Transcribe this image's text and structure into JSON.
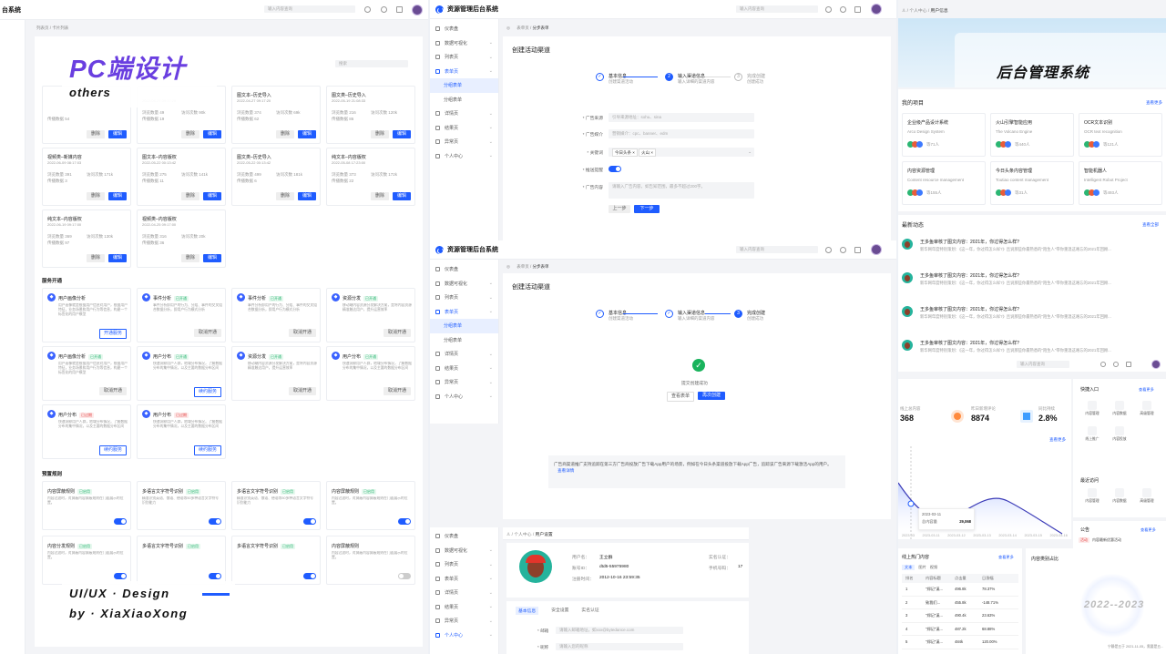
{
  "left_app": {
    "title": "台系统",
    "search_placeholder": "输入内容查询",
    "breadcrumb": "列表页 / 卡片列表",
    "filter_placeholder": "搜索"
  },
  "overlay": {
    "title": "PC端设计",
    "subtitle": "others",
    "footer1": "UI/UX · Design",
    "footer2": "by · XiaXiaoXong"
  },
  "content_cards": [
    {
      "title": "",
      "date": "",
      "m1": "",
      "m2": "",
      "m3": "传播数据 54",
      "m4": ""
    },
    {
      "title": "",
      "date": "2022-04-27 09:17:20",
      "m1": "浏览数量 49",
      "m2": "",
      "m3": "传播数据 19",
      "m4": "访问次数 90k"
    },
    {
      "title": "图文本–历史导入",
      "date": "2022-04-27 09:17:20",
      "m1": "浏览数量 374",
      "m2": "",
      "m3": "传播数据 62",
      "m4": "访问次数 69k"
    },
    {
      "title": "图文类–历史导入",
      "date": "2022-05-19 21:08:33",
      "m1": "浏览数量 216",
      "m2": "",
      "m3": "传播数据 86",
      "m4": "访问次数 120k"
    },
    {
      "title": "视频类–新媒内容",
      "date": "2022-06-09 08:17:03",
      "m1": "浏览数量 391",
      "m2": "",
      "m3": "传播数据 3",
      "m4": "访问次数 171k"
    },
    {
      "title": "图文本–内容版权",
      "date": "2022-05-22 00:13:42",
      "m1": "浏览数量 275",
      "m2": "",
      "m3": "传播数据 11",
      "m4": "访问次数 141k"
    },
    {
      "title": "图文类–历史导入",
      "date": "2022-05-22 00:13:42",
      "m1": "浏览数量 499",
      "m2": "",
      "m3": "传播数据 6",
      "m4": "访问次数 181k"
    },
    {
      "title": "纯文本–内容版权",
      "date": "2022-05-08 17:23:00",
      "m1": "浏览数量 373",
      "m2": "",
      "m3": "传播数据 22",
      "m4": "访问次数 172k"
    },
    {
      "title": "纯文本–内容版权",
      "date": "2022-06-19 09:17:00",
      "m1": "浏览数量 369",
      "m2": "",
      "m3": "传播数据 97",
      "m4": "访问次数 130k"
    },
    {
      "title": "视频类–内容版权",
      "date": "2022-04-25 09:17:00",
      "m1": "浏览数量 316",
      "m2": "",
      "m3": "传播数据 36",
      "m4": "访问次数 20k"
    }
  ],
  "card_btns": {
    "del": "删除",
    "edit": "编辑"
  },
  "service_title": "服务开通",
  "services": [
    {
      "title": "用户画像分析",
      "tag": "",
      "tagc": "",
      "desc": "用户画像就是根据用户信息对用户，根据用户特征，业务场景和用户行为等信息，构建一个标签化的用户模型",
      "btn": "开通服务",
      "btnc": "o"
    },
    {
      "title": "事件分析",
      "tag": "已开通",
      "tagc": "g",
      "desc": "事件分析即用户的行为、分组、事件的交叉组合数据分析，即用户行为模式分析",
      "btn": "取消开通",
      "btnc": "d"
    },
    {
      "title": "事件分析",
      "tag": "已开通",
      "tagc": "g",
      "desc": "事件分析即用户的行为、分组、事件的交叉组合数据分析，即用户行为模式分析",
      "btn": "取消开通",
      "btnc": "d"
    },
    {
      "title": "资源分发",
      "tag": "已开通",
      "tagc": "g",
      "desc": "移动端内容资源分发解决方案，是将内容资源精准触达用户，提升运营效率",
      "btn": "取消开通",
      "btnc": "d"
    },
    {
      "title": "用户画像分析",
      "tag": "已开通",
      "tagc": "g",
      "desc": "用户画像就是根据用户信息对用户，根据用户特征，业务场景和用户行为等信息，构建一个标签化的用户模型",
      "btn": "取消开通",
      "btnc": "d"
    },
    {
      "title": "用户分布",
      "tag": "已开通",
      "tagc": "g",
      "desc": "快速洞察用户人群，地域分布情况，了解数据分布的集中情况，以及主要的数据分布区间",
      "btn": "续约服务",
      "btnc": "o"
    },
    {
      "title": "资源分发",
      "tag": "已开通",
      "tagc": "g",
      "desc": "移动端内容资源分发解决方案，是将内容资源精准触达用户，提升运营效率",
      "btn": "取消开通",
      "btnc": "d"
    },
    {
      "title": "用户分布",
      "tag": "已开通",
      "tagc": "g",
      "desc": "快速洞察用户人群，地域分布情况，了解数据分布的集中情况，以及主要的数据分布区间",
      "btn": "取消开通",
      "btnc": "d"
    },
    {
      "title": "用户分布",
      "tag": "已过期",
      "tagc": "r",
      "desc": "快速洞察用户人群，地域分布情况，了解数据分布的集中情况，以及主要的数据分布区间",
      "btn": "续约服务",
      "btnc": "o"
    },
    {
      "title": "用户分布",
      "tag": "已过期",
      "tagc": "r",
      "desc": "快速洞察用户人群，地域分布情况，了解数据分布的集中情况，以及主要的数据分布区间",
      "btn": "续约服务",
      "btnc": "o"
    }
  ],
  "preset_title": "预置规则",
  "rules": [
    {
      "title": "内容屏蔽规则",
      "tag": "已启用",
      "desc": "内容过滤时，对屏蔽内容屏蔽规则在门面展示的位置。",
      "on": true
    },
    {
      "title": "多语言文字符号识别",
      "tag": "已启用",
      "desc": "精准识别英语、俄语、德语等50多种语言文字符号识别能力",
      "on": true
    },
    {
      "title": "多语言文字符号识别",
      "tag": "已启用",
      "desc": "精准识别英语、俄语、德语等50多种语言文字符号识别能力",
      "on": true
    },
    {
      "title": "内容屏蔽规则",
      "tag": "已启用",
      "desc": "内容过滤时，对屏蔽内容屏蔽规则在门面展示的位置。",
      "on": true
    },
    {
      "title": "内容分发规则",
      "tag": "已启用",
      "desc": "内容过滤时，对屏蔽内容屏蔽规则在门面展示的位置。",
      "on": true
    },
    {
      "title": "多语言文字符号识别",
      "tag": "已启用",
      "desc": "",
      "on": true
    },
    {
      "title": "多语言文字符号识别",
      "tag": "已启用",
      "desc": "",
      "on": true
    },
    {
      "title": "内容屏蔽规则",
      "tag": "",
      "desc": "内容过滤时，对屏蔽内容屏蔽规则在门面展示的位置。",
      "on": false
    }
  ],
  "mid_app": {
    "title": "资源管理后台系统",
    "search_placeholder": "输入内容查询",
    "breadcrumb1": "表单页",
    "breadcrumb2": "分步表单",
    "page_title": "创建活动渠道"
  },
  "menu": [
    "仪表盘",
    "数据可视化",
    "列表页",
    "表单页",
    "分组表单",
    "分组表单",
    "详情页",
    "结果页",
    "异常页",
    "个人中心"
  ],
  "steps": [
    {
      "n": "1",
      "t": "基本信息",
      "d": "创建渠道活动"
    },
    {
      "n": "2",
      "t": "输入渠道信息",
      "d": "输入详细的渠道内容"
    },
    {
      "n": "3",
      "t": "完成创建",
      "d": "创建成功"
    }
  ],
  "form": {
    "l1": "* 广告来源",
    "v1": "引导来源地址：sohu、sina",
    "l2": "* 广告媒介",
    "v2": "营销媒介：cpc、banner、edm",
    "l3": "* 关键词",
    "tag1": "今日头条 ×",
    "tag2": "火山 ×",
    "l4": "* 推送提醒",
    "l5": "* 广告内容",
    "v5": "请输入广告内容，如告知范围，最多不超过200字。",
    "prev": "上一步",
    "next": "下一步"
  },
  "success": {
    "msg": "提交创建成功",
    "btn1": "查看表单",
    "btn2": "再次创建",
    "note": "广告商渠道推广支持追踪在第三方广告商投放广告下载App用户的场景，例如在今日头条渠道投放下载App广告，追踪该广告来源下载激活App的用户。",
    "link": "查看详情"
  },
  "profile": {
    "breadcrumb1": "个人中心",
    "breadcrumb2": "用户设置",
    "user_label": "用户名：",
    "user": "王立群",
    "acc_label": "账号ID：",
    "acc": "dtd5-55975980",
    "reg_label": "注册时间：",
    "reg": "2012-10-16 23:59:35",
    "ver_label": "实名认证：",
    "phone_label": "手机号码：",
    "phone": "17",
    "tabs": [
      "基本信息",
      "安全设置",
      "实名认证"
    ],
    "email_label": "* 邮箱",
    "email": "请输入邮箱地址，如xxx@bytedance.com",
    "nick_label": "* 昵称",
    "nick": "请输入您的昵称"
  },
  "right": {
    "breadcrumb1": "个人中心",
    "breadcrumb2": "用户信息",
    "banner": "后台管理系统",
    "projects_title": "我的项目",
    "more": "查看更多",
    "projects": [
      {
        "t": "企业级产品设计系统",
        "d": "Arco Design System",
        "m": "等71人"
      },
      {
        "t": "火山引擎智能应用",
        "d": "The Volcano Engine",
        "m": "等440人"
      },
      {
        "t": "OCR文本识别",
        "d": "OCR text recognition",
        "m": "等121人"
      },
      {
        "t": "内容资源管理",
        "d": "Content resource management",
        "m": "等155人"
      },
      {
        "t": "今日头条内容管理",
        "d": "Toutiao content management",
        "m": "等31人"
      },
      {
        "t": "智能机器人",
        "d": "Intelligent Robot Project",
        "m": "等493人"
      }
    ],
    "news_title": "最新动态",
    "news_more": "查看全部",
    "news_item": "王多鱼审核了图文内容：2021年，你过得怎么样?",
    "news_sub": "新华网年度特别策划：《这一年，你过得怎么样?》且说那些你最熟悉的\"陌生人\"带你重温这难忘的2021年回顾..."
  },
  "dash": {
    "search_placeholder": "输入内容查询",
    "k1_label": "线上总内容",
    "k1": "368",
    "k2_label": "昨日新增评论",
    "k2": "8874",
    "k3_label": "同比持续",
    "k3": "2.8%",
    "more": "查看更多",
    "chart_value": "29,068",
    "chart_date": "2023-03-11",
    "chart_series": "总内容量",
    "xdates": [
      "2023-03",
      "2023-03-11",
      "2023-03-12",
      "2023-03-13",
      "2023-03-14",
      "2023-03-15",
      "2023-03-16"
    ],
    "quick_title": "快捷入口",
    "quick_more": "查看更多",
    "quick": [
      "内容管理",
      "内容数据",
      "高级管理",
      "线上推广",
      "内容投放"
    ],
    "recent_title": "最近访问",
    "recent": [
      "内容管理",
      "内容数据",
      "高级管理"
    ],
    "notice_title": "公告",
    "notice_more": "查看更多",
    "notices": [
      {
        "tag": "活动",
        "t": "内容最新优惠活动"
      },
      {
        "tag": "消息",
        "t": "新增内容尚未通过审核，详情..."
      },
      {
        "tag": "通知",
        "t": "当前产品试用期即将结束..."
      },
      {
        "tag": "通知",
        "t": "1月新系统升级计划通知"
      },
      {
        "tag": "消息",
        "t": "新增内容已经通过审核，详情..."
      }
    ],
    "hot_title": "线上热门内容",
    "hot_more": "查看更多",
    "hot_tabs": [
      "文本",
      "图片",
      "视频"
    ],
    "hot_cols": [
      "排名",
      "内容标题",
      "点击量",
      "日涨幅"
    ],
    "hot_rows": [
      [
        "1",
        "\"郑记\"溪...",
        "496.8k",
        "78.37%"
      ],
      [
        "2",
        "致我们...",
        "455.8k",
        "-148.71%"
      ],
      [
        "3",
        "\"郑记\"溪...",
        "490.4k",
        "23.63%"
      ],
      [
        "4",
        "\"郑记\"溪...",
        "487.2k",
        "68.88%"
      ],
      [
        "5",
        "\"郑记\"溪...",
        "484k",
        "120.00%"
      ]
    ],
    "cat_title": "内容类别占比",
    "year": "2022--2023",
    "date": "宁静是五于 2021-11-05，需要是五..."
  }
}
